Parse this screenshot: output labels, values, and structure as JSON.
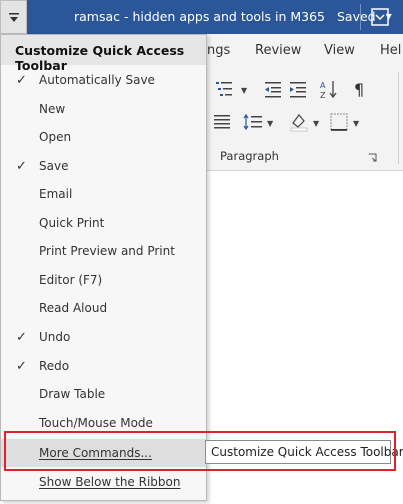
{
  "titlebar": {
    "title": "ramsac - hidden apps and tools in M365",
    "status": "Saved",
    "background_color": "#2b579a"
  },
  "ribbon": {
    "tabs": [
      "ngs",
      "Review",
      "View",
      "Hel"
    ],
    "group_label": "Paragraph"
  },
  "qat_menu": {
    "header": "Customize Quick Access Toolbar",
    "items": [
      {
        "label": "Automatically Save",
        "checked": true
      },
      {
        "label": "New",
        "checked": false
      },
      {
        "label": "Open",
        "checked": false
      },
      {
        "label": "Save",
        "checked": true
      },
      {
        "label": "Email",
        "checked": false
      },
      {
        "label": "Quick Print",
        "checked": false
      },
      {
        "label": "Print Preview and Print",
        "checked": false
      },
      {
        "label": "Editor (F7)",
        "checked": false
      },
      {
        "label": "Read Aloud",
        "checked": false
      },
      {
        "label": "Undo",
        "checked": true
      },
      {
        "label": "Redo",
        "checked": true
      },
      {
        "label": "Draw Table",
        "checked": false
      },
      {
        "label": "Touch/Mouse Mode",
        "checked": false
      },
      {
        "label": "More Commands...",
        "checked": false
      },
      {
        "label": "Show Below the Ribbon",
        "checked": false
      }
    ],
    "check_glyph": "✓"
  },
  "tooltip": {
    "text": "Customize Quick Access Toolbar"
  },
  "colors": {
    "highlight": "#e0202a",
    "menu_hover": "#dedede"
  },
  "icons": [
    "qat-dropdown-icon",
    "ribbon-display-options-icon",
    "multilevel-list-icon",
    "decrease-indent-icon",
    "increase-indent-icon",
    "sort-icon",
    "pilcrow-icon",
    "justify-icon",
    "line-spacing-icon",
    "shading-icon",
    "borders-icon",
    "dialog-launcher-icon",
    "checkmark-icon"
  ]
}
